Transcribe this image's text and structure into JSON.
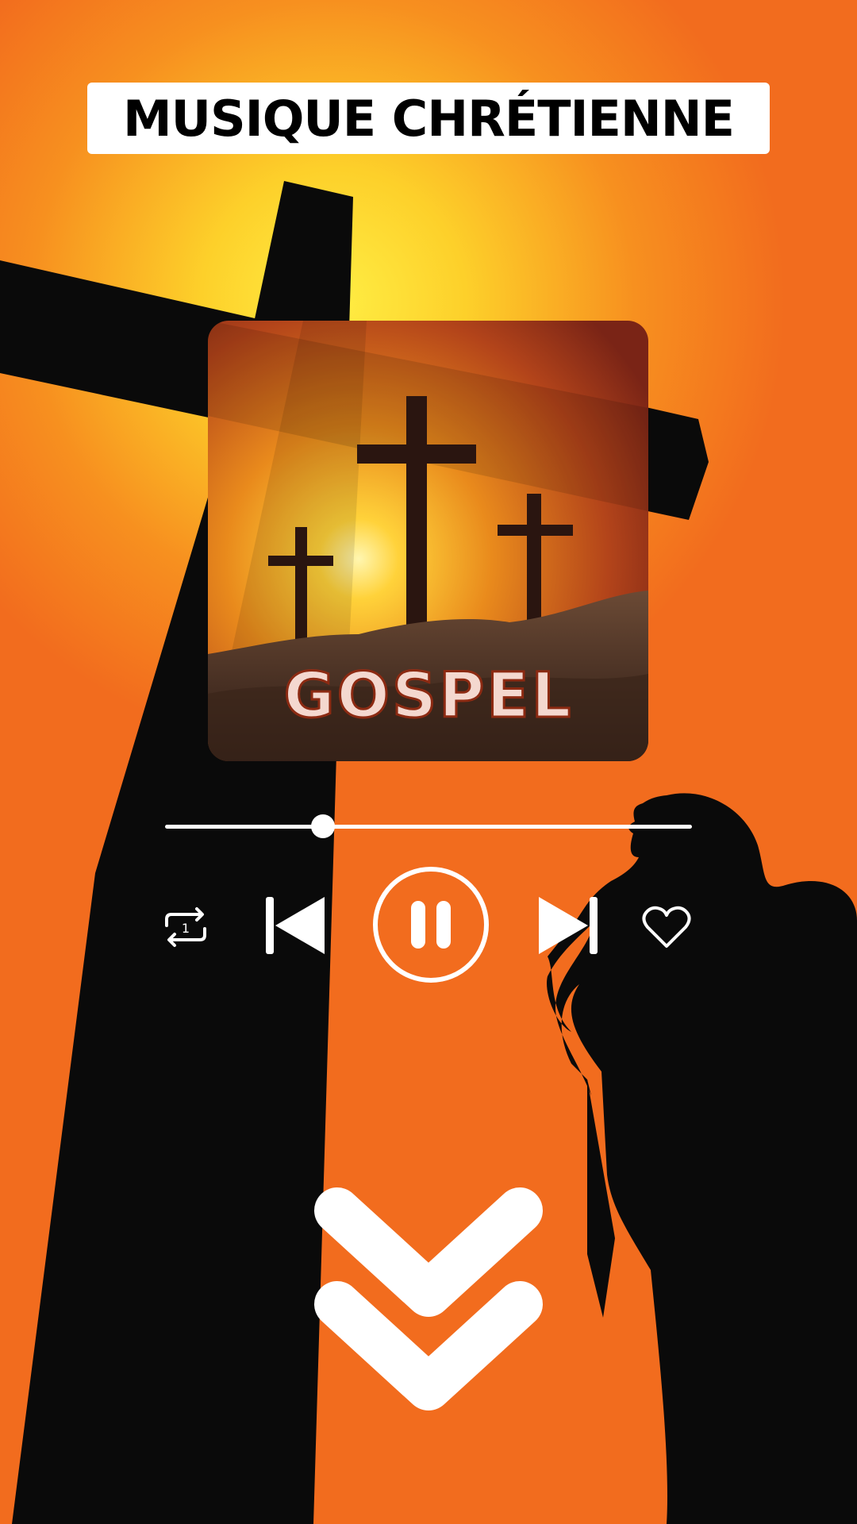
{
  "banner": {
    "title": "MUSIQUE CHRÉTIENNE"
  },
  "album": {
    "label": "GOSPEL"
  },
  "player": {
    "progress_fraction": 0.3,
    "controls": {
      "repeat_icon_badge": "1",
      "repeat_icon": "repeat-one-icon",
      "previous_icon": "skip-previous-icon",
      "pause_icon": "pause-icon",
      "next_icon": "skip-next-icon",
      "favorite_icon": "heart-outline-icon"
    }
  },
  "scroll_hint_icon": "double-chevron-down-icon",
  "colors": {
    "background": "#f26c1e",
    "silhouette": "#0a0a0a",
    "accent": "#ffffff",
    "sun": "#ffe640"
  }
}
